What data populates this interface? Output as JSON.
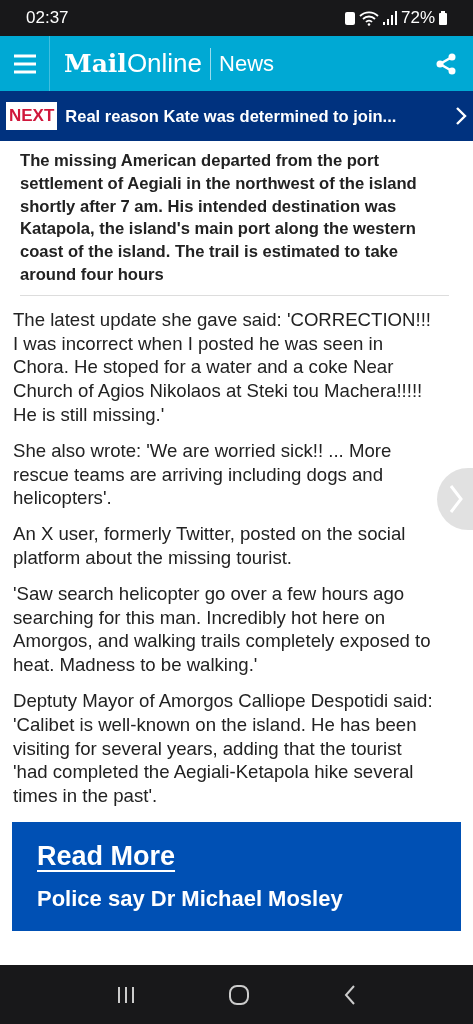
{
  "status_bar": {
    "time": "02:37",
    "battery": "72%"
  },
  "header": {
    "logo_bold": "Mail",
    "logo_light": "Online",
    "section": "News"
  },
  "next_bar": {
    "badge": "NEXT",
    "headline": "Real reason Kate was determined to join..."
  },
  "caption": "The missing American departed from the port settlement of Aegiali in the northwest of the island shortly after 7 am. His intended destination was Katapola, the island's main port along the western coast of the island. The trail is estimated to take around four hours",
  "paragraphs": [
    "The latest update she gave said: 'CORRECTION!!! I was incorrect when I posted he was seen in Chora. He stoped for a water and a coke Near Church of Agios Nikolaos at Steki tou Machera!!!!! He is still missing.'",
    "She also wrote: 'We are worried sick!! ... More rescue teams are arriving including dogs and helicopters'.",
    "An X user, formerly Twitter, posted on the social platform about the missing tourist.",
    "'Saw search helicopter go over a few hours ago searching for this man. Incredibly hot here on Amorgos, and walking trails completely exposed to heat. Madness to be walking.'",
    "Deptuty Mayor of Amorgos Calliope Despotidi said: 'Calibet is well-known on the island. He has been visiting for several years, adding that the tourist 'had completed the Aegiali-Ketapola hike several times in the past'."
  ],
  "read_more": {
    "title": "Read More",
    "headline": "Police say Dr Michael Mosley"
  }
}
